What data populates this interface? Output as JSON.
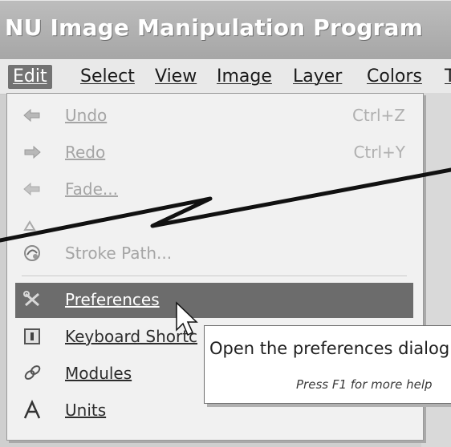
{
  "window": {
    "title": "NU Image Manipulation Program"
  },
  "menubar": {
    "items": [
      {
        "label": "Edit",
        "active": true
      },
      {
        "label": "Select"
      },
      {
        "label": "View"
      },
      {
        "label": "Image"
      },
      {
        "label": "Layer"
      },
      {
        "label": "Colors"
      },
      {
        "label": "T"
      }
    ]
  },
  "edit_menu": {
    "items": [
      {
        "label": "Undo",
        "shortcut": "Ctrl+Z",
        "icon": "undo-icon",
        "disabled": true
      },
      {
        "label": "Redo",
        "shortcut": "Ctrl+Y",
        "icon": "redo-icon",
        "disabled": true
      },
      {
        "label": "Fade...",
        "shortcut": "",
        "icon": "fade-icon",
        "disabled": true
      },
      {
        "label": "",
        "shortcut": "",
        "icon": "hidden-item-icon",
        "disabled": true
      },
      {
        "label": "Stroke Path...",
        "shortcut": "",
        "icon": "stroke-path-icon",
        "disabled": true
      },
      {
        "label": "Preferences",
        "shortcut": "",
        "icon": "preferences-icon",
        "highlighted": true
      },
      {
        "label": "Keyboard Shortc",
        "shortcut": "",
        "icon": "keyboard-shortcuts-icon"
      },
      {
        "label": "Modules",
        "shortcut": "",
        "icon": "modules-icon"
      },
      {
        "label": "Units",
        "shortcut": "",
        "icon": "units-icon"
      }
    ]
  },
  "tooltip": {
    "text": "Open the preferences dialog",
    "help": "Press F1 for more help"
  },
  "colors": {
    "highlight": "#6c6c6c",
    "menu_bg": "#f1f1f1",
    "disabled_text": "#a5a5a5"
  }
}
